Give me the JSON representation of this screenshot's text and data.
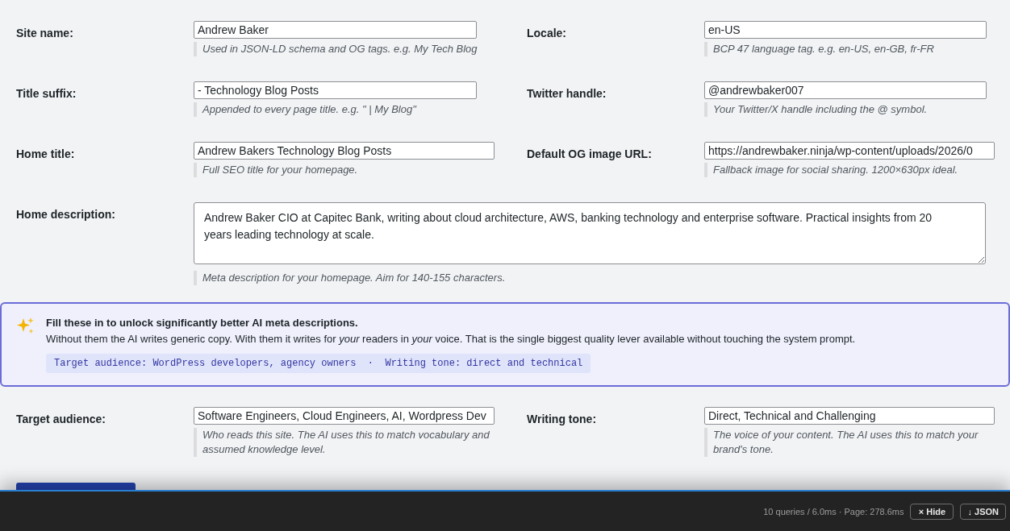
{
  "settings_rows": [
    {
      "fields": [
        {
          "kind": "text",
          "label": "Site name:",
          "value": "Andrew Baker",
          "help": "Used in JSON-LD schema and OG tags. e.g. My Tech Blog"
        },
        {
          "kind": "text",
          "label": "Locale:",
          "value": "en-US",
          "help": "BCP 47 language tag. e.g. en-US, en-GB, fr-FR"
        }
      ]
    },
    {
      "fields": [
        {
          "kind": "text",
          "label": "Title suffix:",
          "value": "- Technology Blog Posts",
          "help": "Appended to every page title. e.g. \" | My Blog\""
        },
        {
          "kind": "text",
          "label": "Twitter handle:",
          "value": "@andrewbaker007",
          "help": "Your Twitter/X handle including the @ symbol."
        }
      ]
    },
    {
      "fields": [
        {
          "kind": "text",
          "label": "Home title:",
          "value": "Andrew Bakers Technology Blog Posts",
          "help": "Full SEO title for your homepage."
        },
        {
          "kind": "text",
          "label": "Default OG image URL:",
          "value": "https://andrewbaker.ninja/wp-content/uploads/2026/0",
          "help": "Fallback image for social sharing. 1200×630px ideal."
        }
      ]
    },
    {
      "fields": [
        {
          "kind": "textarea",
          "label": "Home description:",
          "value": "Andrew Baker CIO at Capitec Bank, writing about cloud architecture, AWS, banking technology and enterprise software. Practical insights from 20 years leading technology at scale.",
          "help": "Meta description for your homepage. Aim for 140-155 characters."
        }
      ]
    }
  ],
  "ai_tip": {
    "title": "Fill these in to unlock significantly better AI meta descriptions.",
    "body": "Without them the AI writes generic copy. With them it writes for *your* readers in *your* voice. That is the single biggest quality lever available without touching the system prompt.",
    "example": "Target audience: WordPress developers, agency owners  ·  Writing tone: direct and technical"
  },
  "voice_rows": [
    {
      "fields": [
        {
          "kind": "text",
          "label": "Target audience:",
          "value": "Software Engineers, Cloud Engineers, AI, Wordpress Dev",
          "help": "Who reads this site. The AI uses this to match vocabulary and assumed knowledge level."
        },
        {
          "kind": "text",
          "label": "Writing tone:",
          "value": "Direct, Technical and Challenging",
          "help": "The voice of your content. The AI uses this to match your brand's tone."
        }
      ]
    }
  ],
  "submit_button": {
    "kind": "primary"
  },
  "debug_bar": {
    "stats": "10 queries / 6.0ms · Page: 278.6ms",
    "buttons": [
      "× Hide",
      "↓ JSON"
    ]
  }
}
